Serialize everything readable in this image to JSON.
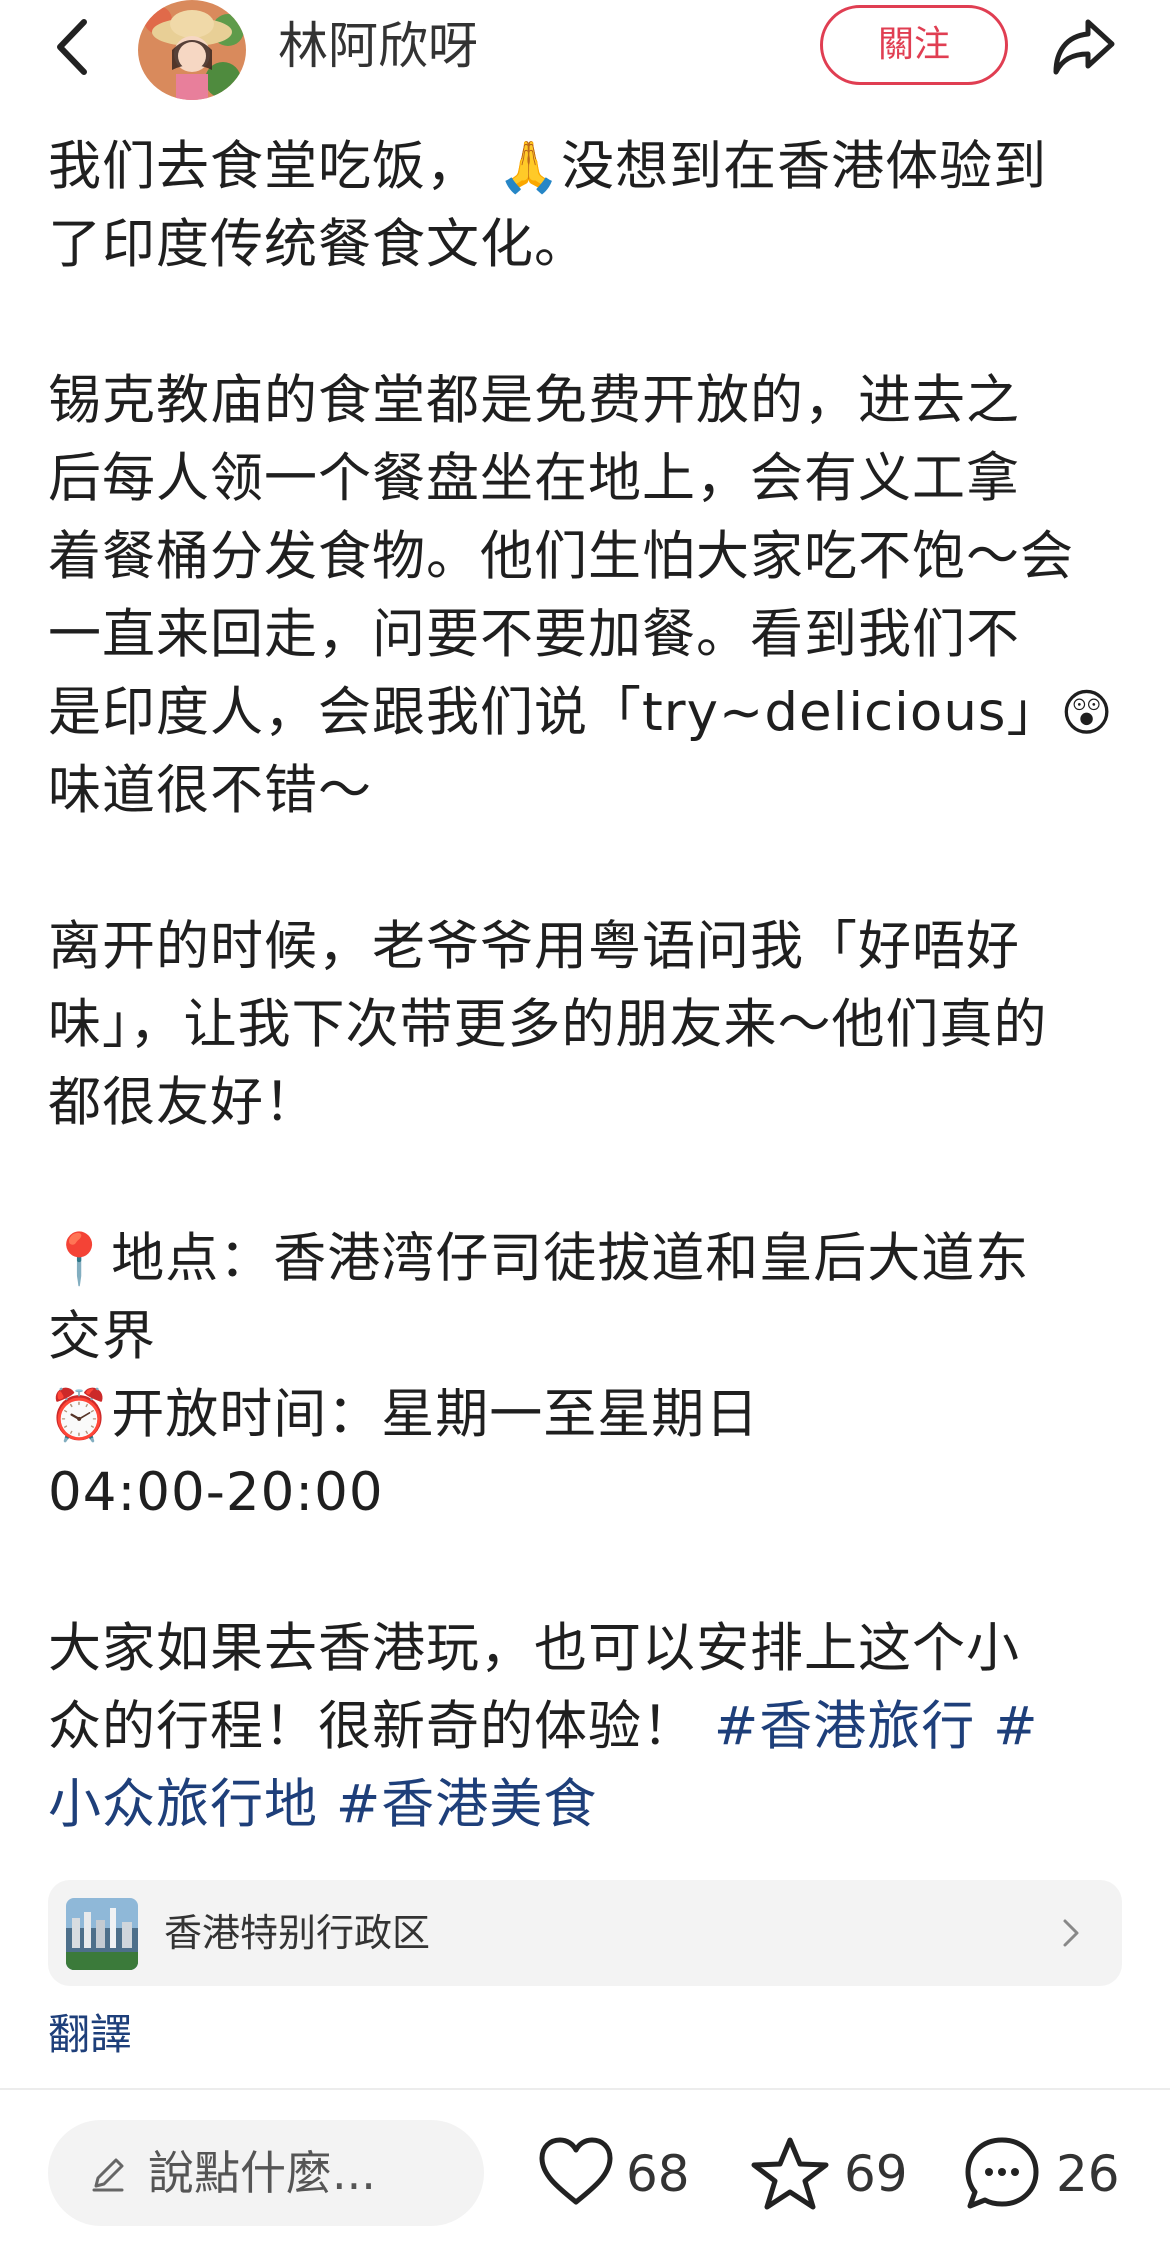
{
  "header": {
    "author_name": "林阿欣呀",
    "follow_label": "關注"
  },
  "post": {
    "lines": {
      "l1a": "我们去食堂吃饭，",
      "l1b": "没想到在香港体验到",
      "l2": "了印度传统餐食文化。",
      "l3": "锡克教庙的食堂都是免费开放的，进去之",
      "l4": "后每人领一个餐盘坐在地上，会有义工拿",
      "l5": "着餐桶分发食物。他们生怕大家吃不饱～会",
      "l6": "一直来回走，问要不要加餐。看到我们不",
      "l7a": "是印度人，会跟我们说「try~delicious」",
      "l8": "味道很不错～",
      "l9": "离开的时候，老爷爷用粤语问我「好唔好",
      "l10": "味」，让我下次带更多的朋友来～他们真的",
      "l11": "都很友好！",
      "l12": "地点：香港湾仔司徒拔道和皇后大道东",
      "l13": "交界",
      "l14": "开放时间：星期一至星期日",
      "l15": "04:00-20:00",
      "l16": "大家如果去香港玩，也可以安排上这个小",
      "l17a": "众的行程！很新奇的体验！",
      "l17b": "#香港旅行",
      "l17c": "#",
      "l18a": "小众旅行地",
      "l18b": "#香港美食"
    },
    "emojis": {
      "bowing": "🙏",
      "shocked": "😲",
      "pin": "📍",
      "clock": "⏰"
    }
  },
  "location": {
    "label": "香港特别行政区"
  },
  "translate_label": "翻譯",
  "bottom_bar": {
    "comment_placeholder": "說點什麼...",
    "likes": "68",
    "collects": "69",
    "comments": "26"
  },
  "colors": {
    "accent_red": "#e03e52",
    "hashtag_blue": "#1e3f7a"
  }
}
